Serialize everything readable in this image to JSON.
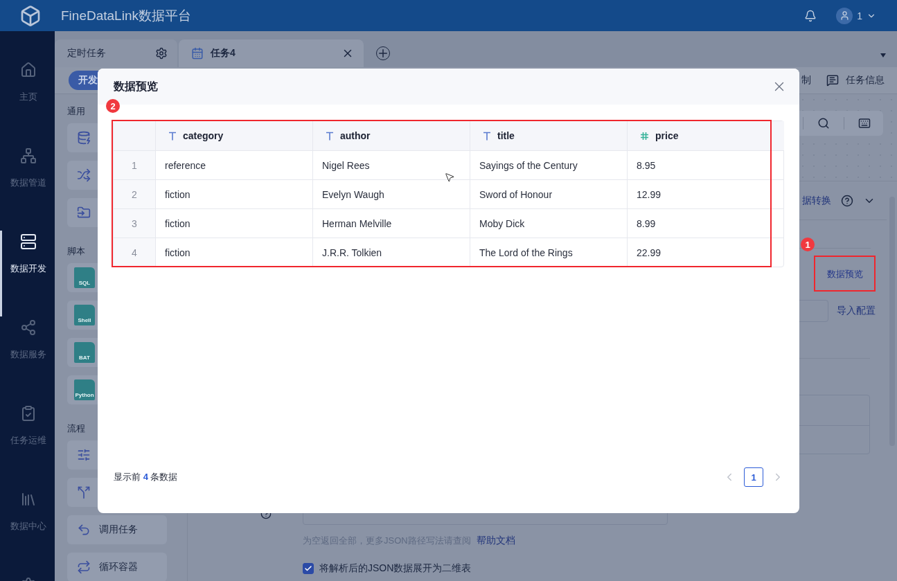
{
  "header": {
    "title": "FineDataLink数据平台",
    "user": "1"
  },
  "nav": [
    {
      "kind": "home",
      "label": "主页",
      "selected": false
    },
    {
      "kind": "pipeline",
      "label": "数据管道",
      "selected": false
    },
    {
      "kind": "develop",
      "label": "数据开发",
      "selected": true
    },
    {
      "kind": "service",
      "label": "数据服务",
      "selected": false
    },
    {
      "kind": "ops",
      "label": "任务运维",
      "selected": false
    },
    {
      "kind": "center",
      "label": "数据中心",
      "selected": false
    }
  ],
  "tabs": [
    {
      "kind": "settings",
      "label": "定时任务",
      "selected": false
    },
    {
      "kind": "task",
      "label": "任务4",
      "selected": true
    }
  ],
  "toolbar": {
    "mode_button": "开发",
    "actions": [
      {
        "kind": "plain",
        "label": "制"
      },
      {
        "kind": "info",
        "label": "任务信息"
      }
    ]
  },
  "palette": [
    {
      "title": "通用",
      "items": [
        {
          "kind": "sync"
        },
        {
          "kind": "transform"
        },
        {
          "kind": "file"
        }
      ]
    },
    {
      "title": "脚本",
      "items": [
        {
          "kind": "script",
          "badge": "SQL"
        },
        {
          "kind": "script",
          "badge": "Shell"
        },
        {
          "kind": "script",
          "badge": "BAT"
        },
        {
          "kind": "script",
          "badge": "Python"
        }
      ]
    },
    {
      "title": "流程",
      "items": [
        {
          "kind": "condition"
        },
        {
          "kind": "parallel"
        },
        {
          "kind": "call",
          "label": "调用任务"
        },
        {
          "kind": "loop",
          "label": "循环容器"
        }
      ]
    }
  ],
  "config": {
    "panel_tab": "据转换",
    "annotation": "1",
    "preview_button": "数据预览",
    "import_link": "导入配置",
    "hint": "为空返回全部，更多JSON路径写法请查阅",
    "help_link": "帮助文档",
    "expand_checkbox": {
      "label": "将解析后的JSON数据展开为二维表",
      "checked": true
    }
  },
  "modal": {
    "title": "数据预览",
    "annotation": "2",
    "columns": [
      {
        "kind": "index"
      },
      {
        "kind": "text",
        "name": "category"
      },
      {
        "kind": "text",
        "name": "author"
      },
      {
        "kind": "text",
        "name": "title"
      },
      {
        "kind": "number",
        "name": "price"
      }
    ],
    "rows": [
      [
        "1",
        "reference",
        "Nigel Rees",
        "Sayings of the Century",
        "8.95"
      ],
      [
        "2",
        "fiction",
        "Evelyn Waugh",
        "Sword of Honour",
        "12.99"
      ],
      [
        "3",
        "fiction",
        "Herman Melville",
        "Moby Dick",
        "8.99"
      ],
      [
        "4",
        "fiction",
        "J.R.R. Tolkien",
        "The Lord of the Rings",
        "22.99"
      ]
    ],
    "footer": "显示前 **4** 条数据",
    "pages": [
      {
        "label": "1",
        "selected": true
      }
    ]
  }
}
